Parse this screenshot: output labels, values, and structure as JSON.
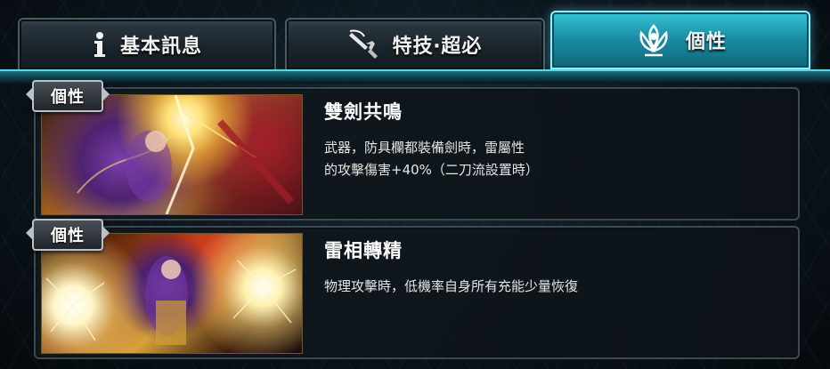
{
  "tabs": [
    {
      "label": "基本訊息",
      "icon": "info-icon",
      "active": false
    },
    {
      "label": "特技‧超必",
      "icon": "sword-icon",
      "active": false
    },
    {
      "label": "個性",
      "icon": "lotus-figure-icon",
      "active": true
    }
  ],
  "colors": {
    "active_tab": "#1b8fa6",
    "tab": "#1a242b",
    "card_border": "#3c4a52"
  },
  "traits": [
    {
      "badge": "個性",
      "title": "雙劍共鳴",
      "description": "武器，防具欄都裝備劍時，雷屬性\n的攻擊傷害+40%（二刀流設置時）"
    },
    {
      "badge": "個性",
      "title": "雷相轉精",
      "description": "物理攻擊時，低機率自身所有充能少量恢復"
    }
  ]
}
